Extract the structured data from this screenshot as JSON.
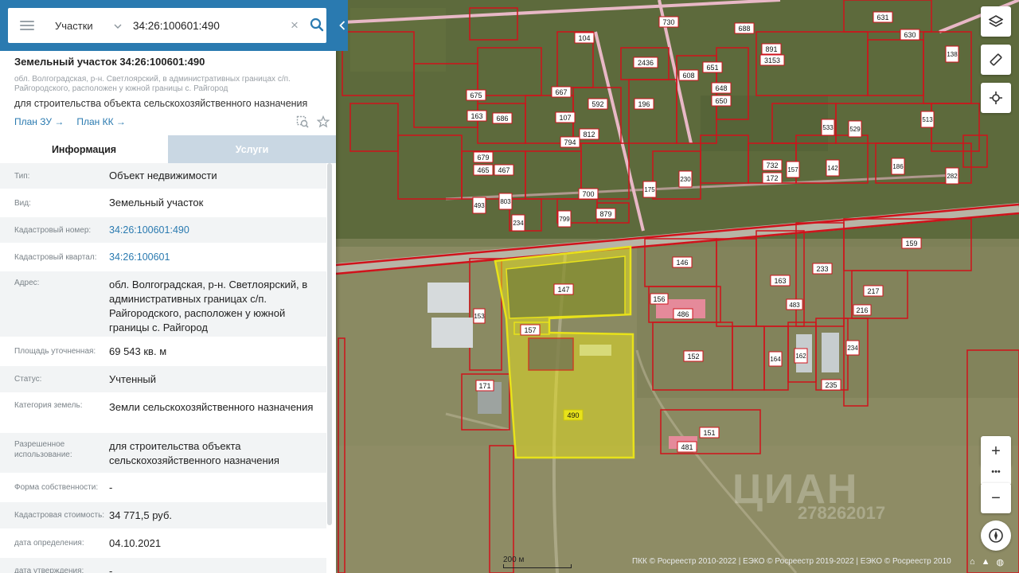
{
  "search": {
    "type_label": "Участки",
    "value": "34:26:100601:490"
  },
  "object": {
    "title": "Земельный участок 34:26:100601:490",
    "address_small": "обл. Волгоградская, р-н. Светлоярский, в административных границах с/п. Райгородского, расположен у южной границы с. Райгород",
    "purpose": "для строительства объекта сельскохозяйственного назначения",
    "link_plan_zu": "План ЗУ →",
    "link_plan_kk": "План КК →"
  },
  "tabs": {
    "info": "Информация",
    "services": "Услуги"
  },
  "rows": [
    {
      "label": "Тип:",
      "value": "Объект недвижимости"
    },
    {
      "label": "Вид:",
      "value": "Земельный участок"
    },
    {
      "label": "Кадастровый номер:",
      "value": "34:26:100601:490"
    },
    {
      "label": "Кадастровый квартал:",
      "value": "34:26:100601"
    },
    {
      "label": "Адрес:",
      "value": "обл. Волгоградская, р-н. Светлоярский, в административных границах с/п. Райгородского, расположен у южной границы с. Райгород"
    },
    {
      "label": "Площадь уточненная:",
      "value": "69 543 кв. м"
    },
    {
      "label": "Статус:",
      "value": "Учтенный"
    },
    {
      "label": "Категория земель:",
      "value": "Земли сельскохозяйственного назначения"
    },
    {
      "label": "Разрешенное использование:",
      "value": "для строительства объекта сельскохозяйственного назначения"
    },
    {
      "label": "Форма собственности:",
      "value": "-"
    },
    {
      "label": "Кадастровая стоимость:",
      "value": "34 771,5 руб."
    },
    {
      "label": "дата определения:",
      "value": "04.10.2021"
    },
    {
      "label": "дата утверждения:",
      "value": "-"
    }
  ],
  "map": {
    "scale_label": "200 м",
    "attribution": "ПКК © Росреестр 2010-2022 | ЕЭКО © Росреестр 2019-2022 | ЕЭКО © Росреестр 2010",
    "watermark": "ЦИАН",
    "watermark_id": "278262017",
    "highlight_color": "#e8e21a",
    "parcel_color": "#d0121b",
    "parcel_labels": {
      "p490": "490",
      "p147": "147",
      "p157": "157",
      "p153": "153",
      "p171": "171",
      "p146": "146",
      "p156": "156",
      "p486": "486",
      "p152": "152",
      "p151": "151",
      "p481": "481",
      "p163": "163",
      "p233": "233",
      "p217": "217",
      "p216": "216",
      "p159": "159",
      "p164": "164",
      "p162": "162",
      "p234": "234",
      "p235": "235",
      "p483": "483",
      "p879": "879",
      "p700": "700",
      "p799": "799",
      "p234b": "234",
      "p803": "803",
      "p493": "493",
      "p175": "175",
      "p230": "230",
      "p172": "172",
      "p732": "732",
      "p157b": "157",
      "p142": "142",
      "p186": "186",
      "p282": "282",
      "p2436": "2436",
      "p196": "196",
      "p592": "592",
      "p812": "812",
      "p794": "794",
      "p107": "107",
      "p667": "667",
      "p675": "675",
      "p686": "686",
      "p163b": "163",
      "p104": "104",
      "p730": "730",
      "p608": "608",
      "p651": "651",
      "p648": "648",
      "p650": "650",
      "p3153": "3153",
      "p891": "891",
      "p688": "688",
      "p631": "631",
      "p630": "630",
      "p138": "138",
      "p513": "513",
      "p529": "529",
      "p533": "533",
      "p465": "465",
      "p467": "467",
      "p679": "679"
    }
  },
  "controls": {
    "zoom_in": "+",
    "zoom_out": "−",
    "more": "•••"
  }
}
